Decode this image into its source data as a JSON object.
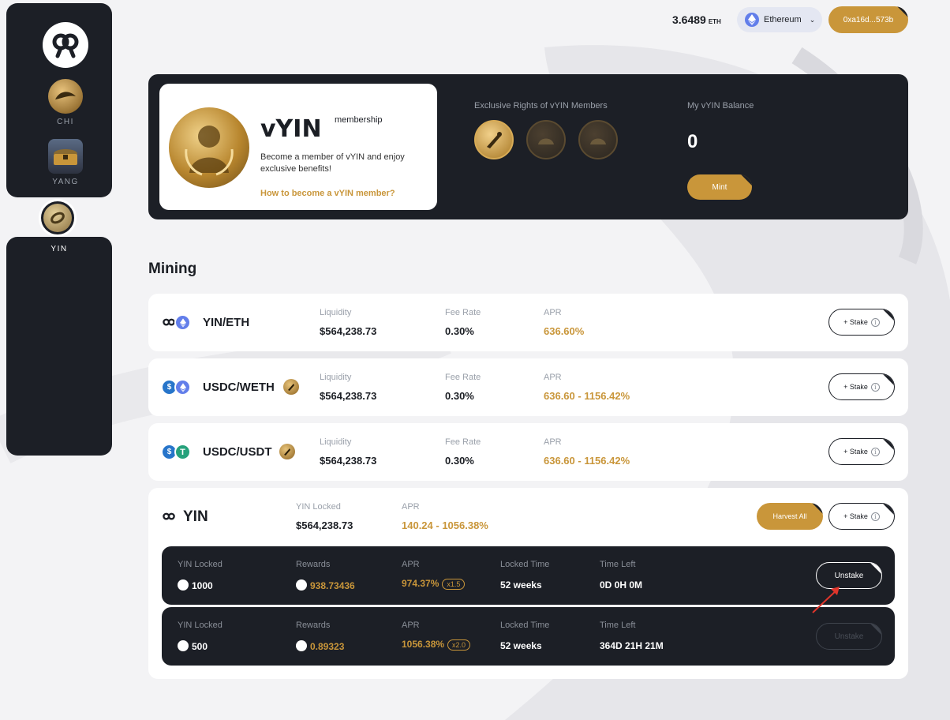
{
  "sidebar": {
    "items": [
      {
        "label": "CHI"
      },
      {
        "label": "YANG"
      },
      {
        "label": "YIN"
      }
    ]
  },
  "header": {
    "eth_balance": "3.6489",
    "eth_unit": "ETH",
    "network": "Ethereum",
    "wallet": "0xa16d...573b"
  },
  "membership": {
    "title": "vYIN",
    "superscript": "membership",
    "description": "Become a member of vYIN and enjoy exclusive benefits!",
    "link": "How to become a vYIN member?",
    "rights_title": "Exclusive Rights of vYIN Members",
    "balance_label": "My vYIN Balance",
    "balance_value": "0",
    "mint_label": "Mint"
  },
  "mining": {
    "title": "Mining",
    "pools": [
      {
        "name": "YIN/ETH",
        "liq_label": "Liquidity",
        "liq": "$564,238.73",
        "fee_label": "Fee Rate",
        "fee": "0.30%",
        "apr_label": "APR",
        "apr": "636.60%",
        "stake": "+ Stake"
      },
      {
        "name": "USDC/WETH",
        "liq_label": "Liquidity",
        "liq": "$564,238.73",
        "fee_label": "Fee Rate",
        "fee": "0.30%",
        "apr_label": "APR",
        "apr": "636.60 - 1156.42%",
        "stake": "+ Stake"
      },
      {
        "name": "USDC/USDT",
        "liq_label": "Liquidity",
        "liq": "$564,238.73",
        "fee_label": "Fee Rate",
        "fee": "0.30%",
        "apr_label": "APR",
        "apr": "636.60 - 1156.42%",
        "stake": "+ Stake"
      }
    ],
    "yin": {
      "name": "YIN",
      "locked_label": "YIN Locked",
      "locked": "$564,238.73",
      "apr_label": "APR",
      "apr": "140.24 - 1056.38%",
      "harvest": "Harvest All",
      "stake": "+ Stake",
      "columns": {
        "locked": "YIN Locked",
        "rewards": "Rewards",
        "apr": "APR",
        "locked_time": "Locked Time",
        "time_left": "Time Left"
      },
      "positions": [
        {
          "locked": "1000",
          "rewards": "938.73436",
          "apr": "974.37%",
          "mult": "x1.5",
          "locked_time": "52 weeks",
          "time_left": "0D 0H 0M",
          "unstake": "Unstake",
          "enabled": true
        },
        {
          "locked": "500",
          "rewards": "0.89323",
          "apr": "1056.38%",
          "mult": "x2.0",
          "locked_time": "52 weeks",
          "time_left": "364D 21H 21M",
          "unstake": "Unstake",
          "enabled": false
        }
      ]
    }
  },
  "colors": {
    "dark": "#1c1f26",
    "gold": "#c9963a",
    "background": "#f3f3f5",
    "eth": "#627eea",
    "usdc": "#2775ca",
    "usdt": "#26a17b",
    "arrow": "#e0352b"
  }
}
